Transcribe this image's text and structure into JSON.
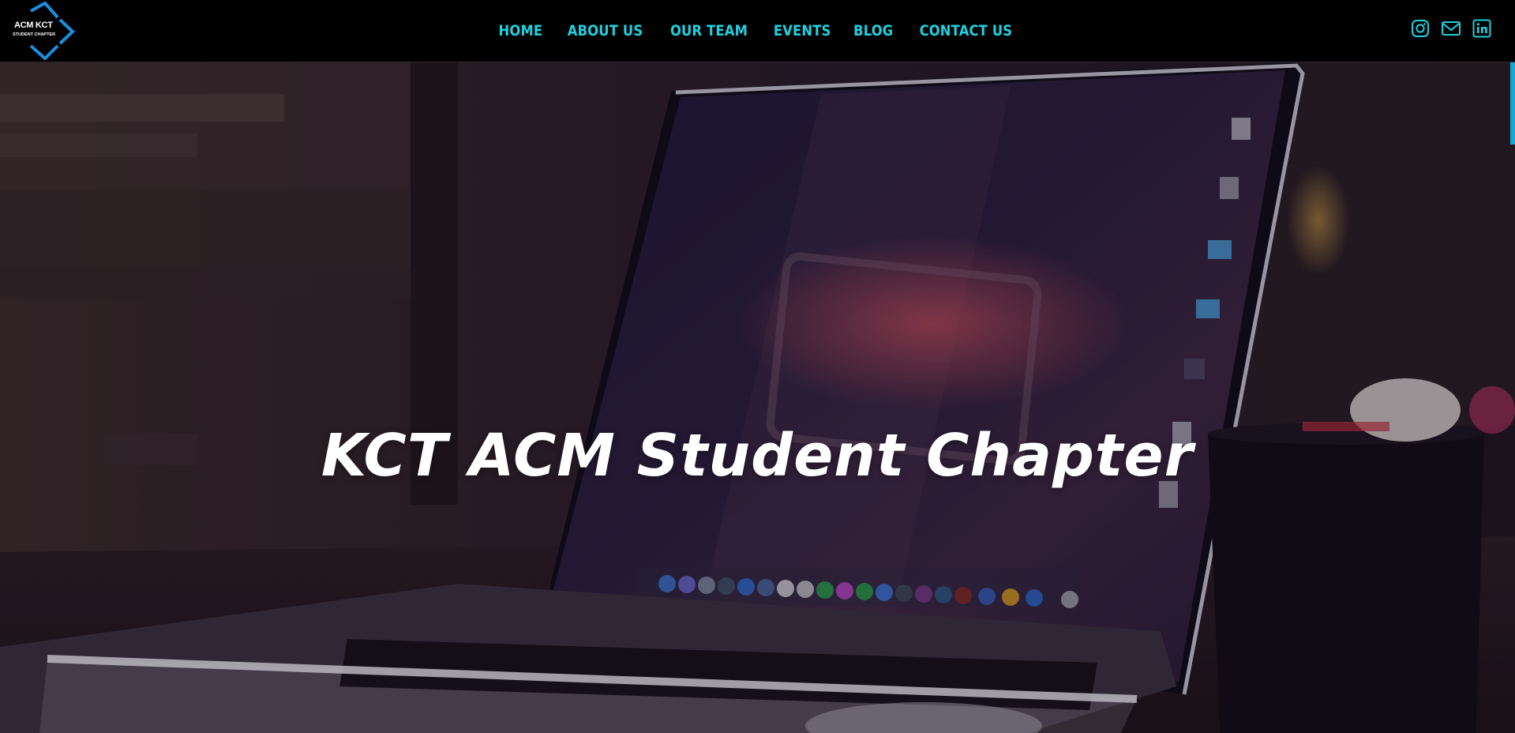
{
  "brand": {
    "logo_title": "ACM KCT",
    "logo_subtitle": "STUDENT CHAPTER"
  },
  "nav": {
    "items": [
      {
        "label": "HOME"
      },
      {
        "label": "ABOUT US"
      },
      {
        "label": "OUR TEAM"
      },
      {
        "label": "EVENTS"
      },
      {
        "label": "BLOG"
      },
      {
        "label": "CONTACT US"
      }
    ]
  },
  "social": {
    "icons": [
      "instagram-icon",
      "mail-icon",
      "linkedin-icon"
    ]
  },
  "hero": {
    "title": "KCT ACM Student Chapter"
  },
  "colors": {
    "accent": "#1fd1e0",
    "logo_blue": "#1a8fe0",
    "navbar_bg": "#000000",
    "hero_text": "#ffffff"
  }
}
